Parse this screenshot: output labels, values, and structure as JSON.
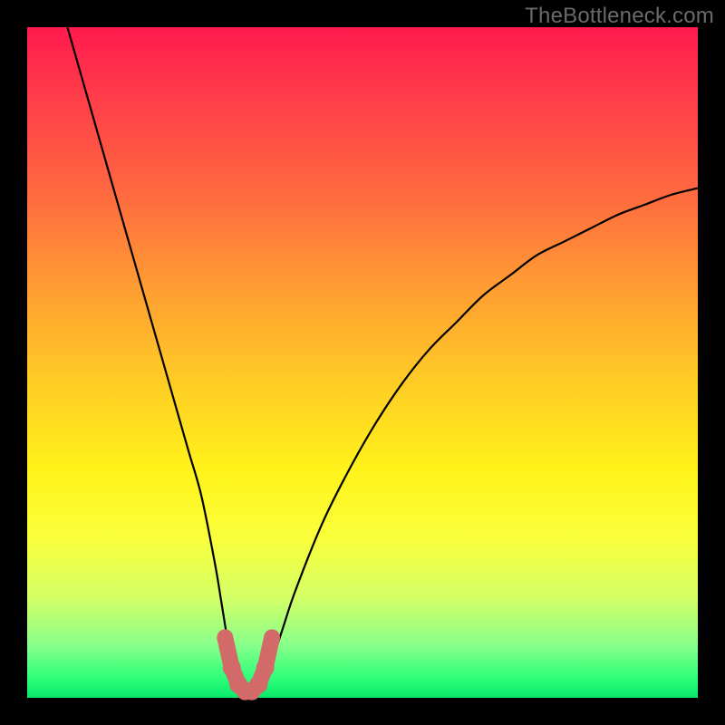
{
  "watermark": "TheBottleneck.com",
  "colors": {
    "page_bg": "#000000",
    "gradient_top": "#ff1a4d",
    "gradient_bottom": "#08e86a",
    "curve_stroke": "#000000",
    "marker_stroke": "#d26a6a",
    "marker_fill": "#d26a6a"
  },
  "chart_data": {
    "type": "line",
    "title": "",
    "xlabel": "",
    "ylabel": "",
    "xlim": [
      0,
      100
    ],
    "ylim": [
      0,
      100
    ],
    "grid": false,
    "legend": false,
    "series": [
      {
        "name": "bottleneck-curve",
        "x": [
          6,
          8,
          10,
          12,
          14,
          16,
          18,
          20,
          22,
          24,
          26,
          28,
          29,
          30,
          31,
          32,
          33,
          34,
          35,
          36,
          38,
          40,
          44,
          48,
          52,
          56,
          60,
          64,
          68,
          72,
          76,
          80,
          84,
          88,
          92,
          96,
          100
        ],
        "y": [
          100,
          93,
          86,
          79,
          72,
          65,
          58,
          51,
          44,
          37,
          30,
          20,
          14,
          8,
          4,
          2,
          1,
          1,
          2,
          4,
          10,
          16,
          26,
          34,
          41,
          47,
          52,
          56,
          60,
          63,
          66,
          68,
          70,
          72,
          73.5,
          75,
          76
        ]
      },
      {
        "name": "optimal-region-markers",
        "x": [
          29.5,
          30.5,
          31.5,
          32.5,
          33.5,
          34.5,
          35.5,
          36.5
        ],
        "y": [
          9,
          4.5,
          2,
          1,
          1,
          2,
          4.5,
          9
        ]
      }
    ],
    "annotations": [
      {
        "text": "TheBottleneck.com",
        "role": "watermark",
        "position": "top-right"
      }
    ]
  }
}
